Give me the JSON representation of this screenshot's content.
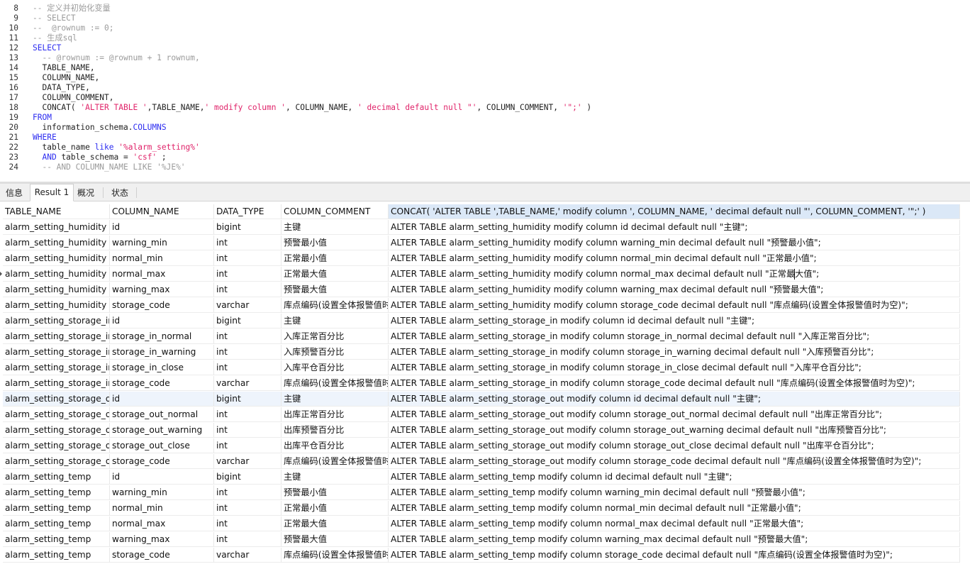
{
  "editor": {
    "lines": [
      {
        "num": "8",
        "tokens": [
          {
            "t": "-- 定义并初始化变量",
            "c": "comment"
          }
        ]
      },
      {
        "num": "9",
        "tokens": [
          {
            "t": "-- SELECT",
            "c": "comment"
          }
        ]
      },
      {
        "num": "10",
        "tokens": [
          {
            "t": "--  @rownum := 0;",
            "c": "comment"
          }
        ]
      },
      {
        "num": "11",
        "tokens": [
          {
            "t": "-- 生成sql",
            "c": "comment"
          }
        ]
      },
      {
        "num": "12",
        "tokens": [
          {
            "t": "SELECT",
            "c": "keyword"
          }
        ]
      },
      {
        "num": "13",
        "tokens": [
          {
            "t": "  -- @rownum := @rownum + 1 rownum,",
            "c": "comment"
          }
        ]
      },
      {
        "num": "14",
        "tokens": [
          {
            "t": "  TABLE_NAME,",
            "c": "plain"
          }
        ]
      },
      {
        "num": "15",
        "tokens": [
          {
            "t": "  COLUMN_NAME,",
            "c": "plain"
          }
        ]
      },
      {
        "num": "16",
        "tokens": [
          {
            "t": "  DATA_TYPE,",
            "c": "plain"
          }
        ]
      },
      {
        "num": "17",
        "tokens": [
          {
            "t": "  COLUMN_COMMENT,",
            "c": "plain"
          }
        ]
      },
      {
        "num": "18",
        "tokens": [
          {
            "t": "  CONCAT( ",
            "c": "plain"
          },
          {
            "t": "'ALTER TABLE '",
            "c": "string"
          },
          {
            "t": ",TABLE_NAME,",
            "c": "plain"
          },
          {
            "t": "' modify column '",
            "c": "string"
          },
          {
            "t": ", COLUMN_NAME, ",
            "c": "plain"
          },
          {
            "t": "' decimal default null \"'",
            "c": "string"
          },
          {
            "t": ", COLUMN_COMMENT, ",
            "c": "plain"
          },
          {
            "t": "'\";'",
            "c": "string"
          },
          {
            "t": " )",
            "c": "plain"
          }
        ]
      },
      {
        "num": "19",
        "tokens": [
          {
            "t": "FROM",
            "c": "keyword"
          }
        ]
      },
      {
        "num": "20",
        "tokens": [
          {
            "t": "  information_schema.",
            "c": "plain"
          },
          {
            "t": "COLUMNS",
            "c": "keyword"
          }
        ]
      },
      {
        "num": "21",
        "tokens": [
          {
            "t": "WHERE",
            "c": "keyword"
          }
        ]
      },
      {
        "num": "22",
        "tokens": [
          {
            "t": "  table_name ",
            "c": "plain"
          },
          {
            "t": "like",
            "c": "keyword"
          },
          {
            "t": " ",
            "c": "plain"
          },
          {
            "t": "'%alarm_setting%'",
            "c": "string"
          }
        ]
      },
      {
        "num": "23",
        "tokens": [
          {
            "t": "  ",
            "c": "plain"
          },
          {
            "t": "AND",
            "c": "keyword"
          },
          {
            "t": " table_schema = ",
            "c": "plain"
          },
          {
            "t": "'csf'",
            "c": "string"
          },
          {
            "t": " ;",
            "c": "plain"
          }
        ]
      },
      {
        "num": "24",
        "tokens": [
          {
            "t": "  -- AND COLUMN_NAME LIKE '%JE%'",
            "c": "comment"
          }
        ]
      }
    ]
  },
  "tabs": [
    {
      "label": "信息",
      "active": false
    },
    {
      "label": "Result 1",
      "active": true
    },
    {
      "label": "概况",
      "active": false
    },
    {
      "label": "状态",
      "active": false
    }
  ],
  "grid": {
    "columns": [
      "TABLE_NAME",
      "COLUMN_NAME",
      "DATA_TYPE",
      "COLUMN_COMMENT",
      "CONCAT( 'ALTER TABLE ',TABLE_NAME,' modify column ', COLUMN_NAME, ' decimal default null \"', COLUMN_COMMENT, '\";' )"
    ],
    "rows": [
      [
        "alarm_setting_humidity",
        "id",
        "bigint",
        "主键",
        "ALTER TABLE alarm_setting_humidity modify column id decimal default null \"主键\";"
      ],
      [
        "alarm_setting_humidity",
        "warning_min",
        "int",
        "预警最小值",
        "ALTER TABLE alarm_setting_humidity modify column warning_min decimal default null \"预警最小值\";"
      ],
      [
        "alarm_setting_humidity",
        "normal_min",
        "int",
        "正常最小值",
        "ALTER TABLE alarm_setting_humidity modify column normal_min decimal default null \"正常最小值\";"
      ],
      [
        "alarm_setting_humidity",
        "normal_max",
        "int",
        "正常最大值",
        "ALTER TABLE alarm_setting_humidity modify column normal_max decimal default null \"正常最大值\";"
      ],
      [
        "alarm_setting_humidity",
        "warning_max",
        "int",
        "预警最大值",
        "ALTER TABLE alarm_setting_humidity modify column warning_max decimal default null \"预警最大值\";"
      ],
      [
        "alarm_setting_humidity",
        "storage_code",
        "varchar",
        "库点编码(设置全体报警值时为空)",
        "ALTER TABLE alarm_setting_humidity modify column storage_code decimal default null \"库点编码(设置全体报警值时为空)\";"
      ],
      [
        "alarm_setting_storage_in",
        "id",
        "bigint",
        "主键",
        "ALTER TABLE alarm_setting_storage_in modify column id decimal default null \"主键\";"
      ],
      [
        "alarm_setting_storage_in",
        "storage_in_normal",
        "int",
        "入库正常百分比",
        "ALTER TABLE alarm_setting_storage_in modify column storage_in_normal decimal default null \"入库正常百分比\";"
      ],
      [
        "alarm_setting_storage_in",
        "storage_in_warning",
        "int",
        "入库预警百分比",
        "ALTER TABLE alarm_setting_storage_in modify column storage_in_warning decimal default null \"入库预警百分比\";"
      ],
      [
        "alarm_setting_storage_in",
        "storage_in_close",
        "int",
        "入库平仓百分比",
        "ALTER TABLE alarm_setting_storage_in modify column storage_in_close decimal default null \"入库平仓百分比\";"
      ],
      [
        "alarm_setting_storage_in",
        "storage_code",
        "varchar",
        "库点编码(设置全体报警值时为空)",
        "ALTER TABLE alarm_setting_storage_in modify column storage_code decimal default null \"库点编码(设置全体报警值时为空)\";"
      ],
      [
        "alarm_setting_storage_out",
        "id",
        "bigint",
        "主键",
        "ALTER TABLE alarm_setting_storage_out modify column id decimal default null \"主键\";"
      ],
      [
        "alarm_setting_storage_out",
        "storage_out_normal",
        "int",
        "出库正常百分比",
        "ALTER TABLE alarm_setting_storage_out modify column storage_out_normal decimal default null \"出库正常百分比\";"
      ],
      [
        "alarm_setting_storage_out",
        "storage_out_warning",
        "int",
        "出库预警百分比",
        "ALTER TABLE alarm_setting_storage_out modify column storage_out_warning decimal default null \"出库预警百分比\";"
      ],
      [
        "alarm_setting_storage_out",
        "storage_out_close",
        "int",
        "出库平仓百分比",
        "ALTER TABLE alarm_setting_storage_out modify column storage_out_close decimal default null \"出库平仓百分比\";"
      ],
      [
        "alarm_setting_storage_out",
        "storage_code",
        "varchar",
        "库点编码(设置全体报警值时为空)",
        "ALTER TABLE alarm_setting_storage_out modify column storage_code decimal default null \"库点编码(设置全体报警值时为空)\";"
      ],
      [
        "alarm_setting_temp",
        "id",
        "bigint",
        "主键",
        "ALTER TABLE alarm_setting_temp modify column id decimal default null \"主键\";"
      ],
      [
        "alarm_setting_temp",
        "warning_min",
        "int",
        "预警最小值",
        "ALTER TABLE alarm_setting_temp modify column warning_min decimal default null \"预警最小值\";"
      ],
      [
        "alarm_setting_temp",
        "normal_min",
        "int",
        "正常最小值",
        "ALTER TABLE alarm_setting_temp modify column normal_min decimal default null \"正常最小值\";"
      ],
      [
        "alarm_setting_temp",
        "normal_max",
        "int",
        "正常最大值",
        "ALTER TABLE alarm_setting_temp modify column normal_max decimal default null \"正常最大值\";"
      ],
      [
        "alarm_setting_temp",
        "warning_max",
        "int",
        "预警最大值",
        "ALTER TABLE alarm_setting_temp modify column warning_max decimal default null \"预警最大值\";"
      ],
      [
        "alarm_setting_temp",
        "storage_code",
        "varchar",
        "库点编码(设置全体报警值时为空)",
        "ALTER TABLE alarm_setting_temp modify column storage_code decimal default null \"库点编码(设置全体报警值时为空)\";"
      ]
    ],
    "current_row": 3,
    "selected_row": 11
  }
}
